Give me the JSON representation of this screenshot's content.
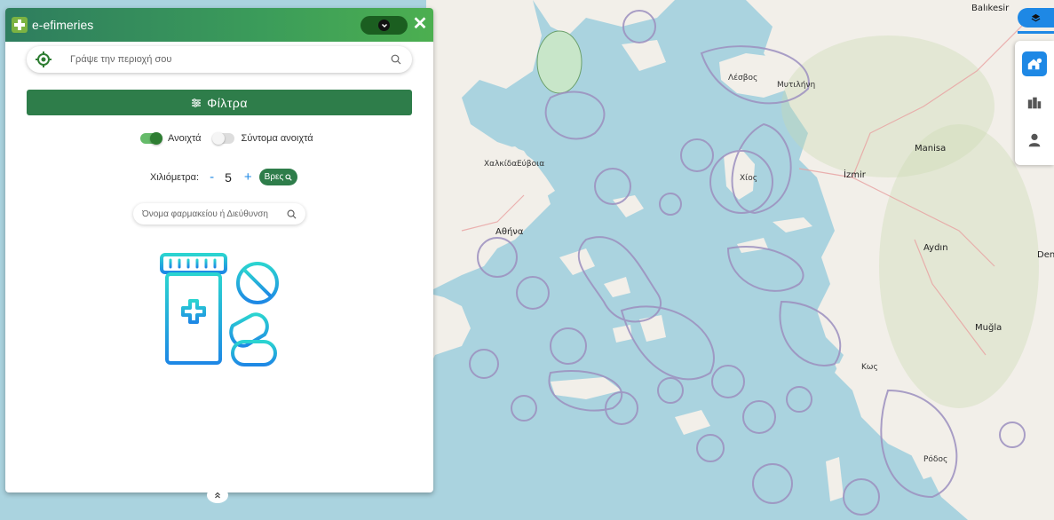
{
  "app": {
    "brand": "e-efimeries"
  },
  "search": {
    "placeholder": "Γράψε την περιοχή σου"
  },
  "filters": {
    "label": "Φίλτρα"
  },
  "switches": {
    "open_label": "Ανοιχτά",
    "soon_open_label": "Σύντομα ανοιχτά",
    "open_on": true,
    "soon_open_on": false
  },
  "distance": {
    "label": "Χιλιόμετρα:",
    "minus": "-",
    "value": "5",
    "plus": "+",
    "find_label": "Βρες"
  },
  "name_search": {
    "placeholder": "Όνομα φαρμακείου ή Διεύθυνση"
  },
  "map": {
    "labels": {
      "balikesir": "Balıkesir",
      "manisa": "Manisa",
      "izmir": "İzmir",
      "aydin": "Aydın",
      "mugla": "Muğla",
      "deni": "Deni",
      "athina": "Αθήνα",
      "evvoia": "Εύβοια",
      "chios": "Χίος",
      "lesvos": "Λέσβος",
      "mytilini": "Μυτιλήνη",
      "rodos": "Ρόδος",
      "chalkida": "Χαλκίδα",
      "kos": "Κως"
    }
  },
  "icons": [
    "layers-icon",
    "home-location-icon",
    "buildings-icon",
    "user-icon",
    "location-target-icon",
    "search-icon",
    "filter-icon",
    "chevron-down-icon",
    "close-icon",
    "chevron-up-icon"
  ],
  "colors": {
    "accent_green": "#2e7d4a",
    "accent_blue": "#1e88e5",
    "sea": "#aad3df",
    "land": "#f2efe9"
  }
}
